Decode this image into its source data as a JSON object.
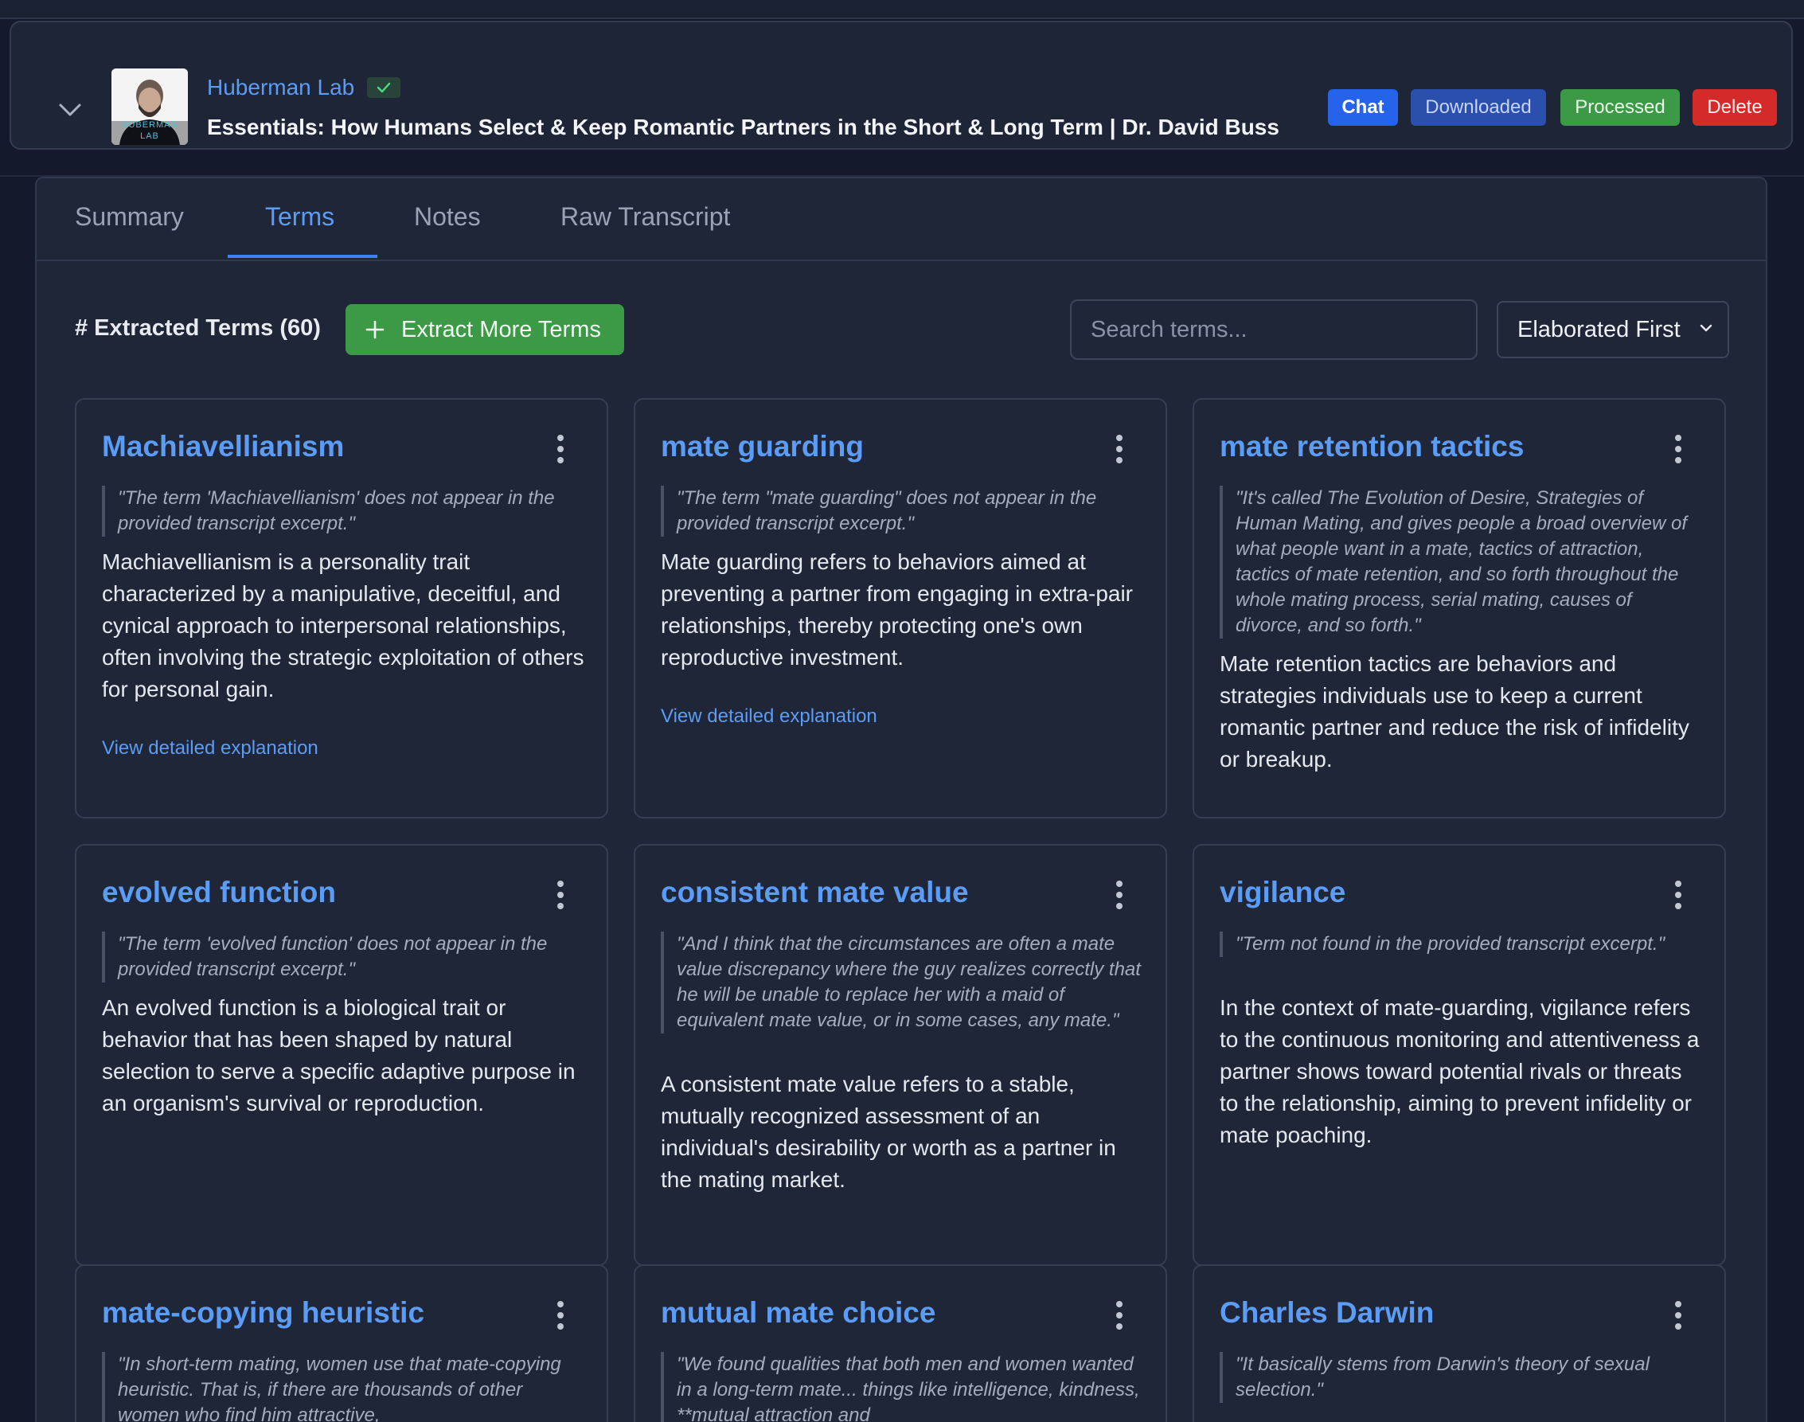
{
  "header": {
    "channel": "Huberman Lab",
    "avatar_text": "HUBERMAN LAB",
    "title": "Essentials: How Humans Select & Keep Romantic Partners in the Short & Long Term | Dr. David Buss",
    "buttons": {
      "chat": "Chat",
      "downloaded": "Downloaded",
      "processed": "Processed",
      "delete": "Delete"
    }
  },
  "tabs": [
    "Summary",
    "Terms",
    "Notes",
    "Raw Transcript"
  ],
  "active_tab": "Terms",
  "toolbar": {
    "title": "# Extracted Terms (60)",
    "extract_label": "Extract More Terms",
    "search_placeholder": "Search terms...",
    "sort_value": "Elaborated First"
  },
  "cards": [
    {
      "term": "Machiavellianism",
      "quote": "\"The term 'Machiavellianism' does not appear in the provided transcript excerpt.\"",
      "description": "Machiavellianism is a personality trait characterized by a manipulative, deceitful, and cynical approach to interpersonal relationships, often involving the strategic exploitation of others for personal gain.",
      "link": "View detailed explanation"
    },
    {
      "term": "mate guarding",
      "quote": "\"The term \"mate guarding\" does not appear in the provided transcript excerpt.\"",
      "description": "Mate guarding refers to behaviors aimed at preventing a partner from engaging in extra-pair relationships, thereby protecting one's own reproductive investment.",
      "link": "View detailed explanation"
    },
    {
      "term": "mate retention tactics",
      "quote": "\"It's called The Evolution of Desire, Strategies of Human Mating, and gives people a broad overview of what people want in a mate, tactics of attraction, tactics of mate retention, and so forth throughout the whole mating process, serial mating, causes of divorce, and so forth.\"",
      "description": "Mate retention tactics are behaviors and strategies individuals use to keep a current romantic partner and reduce the risk of infidelity or breakup.",
      "link": ""
    },
    {
      "term": "evolved function",
      "quote": "\"The term 'evolved function' does not appear in the provided transcript excerpt.\"",
      "description": "An evolved function is a biological trait or behavior that has been shaped by natural selection to serve a specific adaptive purpose in an organism's survival or reproduction.",
      "link": ""
    },
    {
      "term": "consistent mate value",
      "quote": "\"And I think that the circumstances are often a mate value discrepancy where the guy realizes correctly that he will be unable to replace her with a maid of equivalent mate value, or in some cases, any mate.\"",
      "description": "A consistent mate value refers to a stable, mutually recognized assessment of an individual's desirability or worth as a partner in the mating market.",
      "link": ""
    },
    {
      "term": "vigilance",
      "quote": "\"Term not found in the provided transcript excerpt.\"",
      "description": "In the context of mate-guarding, vigilance refers to the continuous monitoring and attentiveness a partner shows toward potential rivals or threats to the relationship, aiming to prevent infidelity or mate poaching.",
      "link": ""
    },
    {
      "term": "mate-copying heuristic",
      "quote": "\"In short-term mating, women use that mate-copying heuristic. That is, if there are thousands of other women who find him attractive,",
      "description": "",
      "link": ""
    },
    {
      "term": "mutual mate choice",
      "quote": "\"We found qualities that both men and women wanted in a long-term mate... things like intelligence, kindness, **mutual attraction and",
      "description": "",
      "link": ""
    },
    {
      "term": "Charles Darwin",
      "quote": "\"It basically stems from Darwin's theory of sexual selection.\"",
      "description": "",
      "link": ""
    }
  ]
}
